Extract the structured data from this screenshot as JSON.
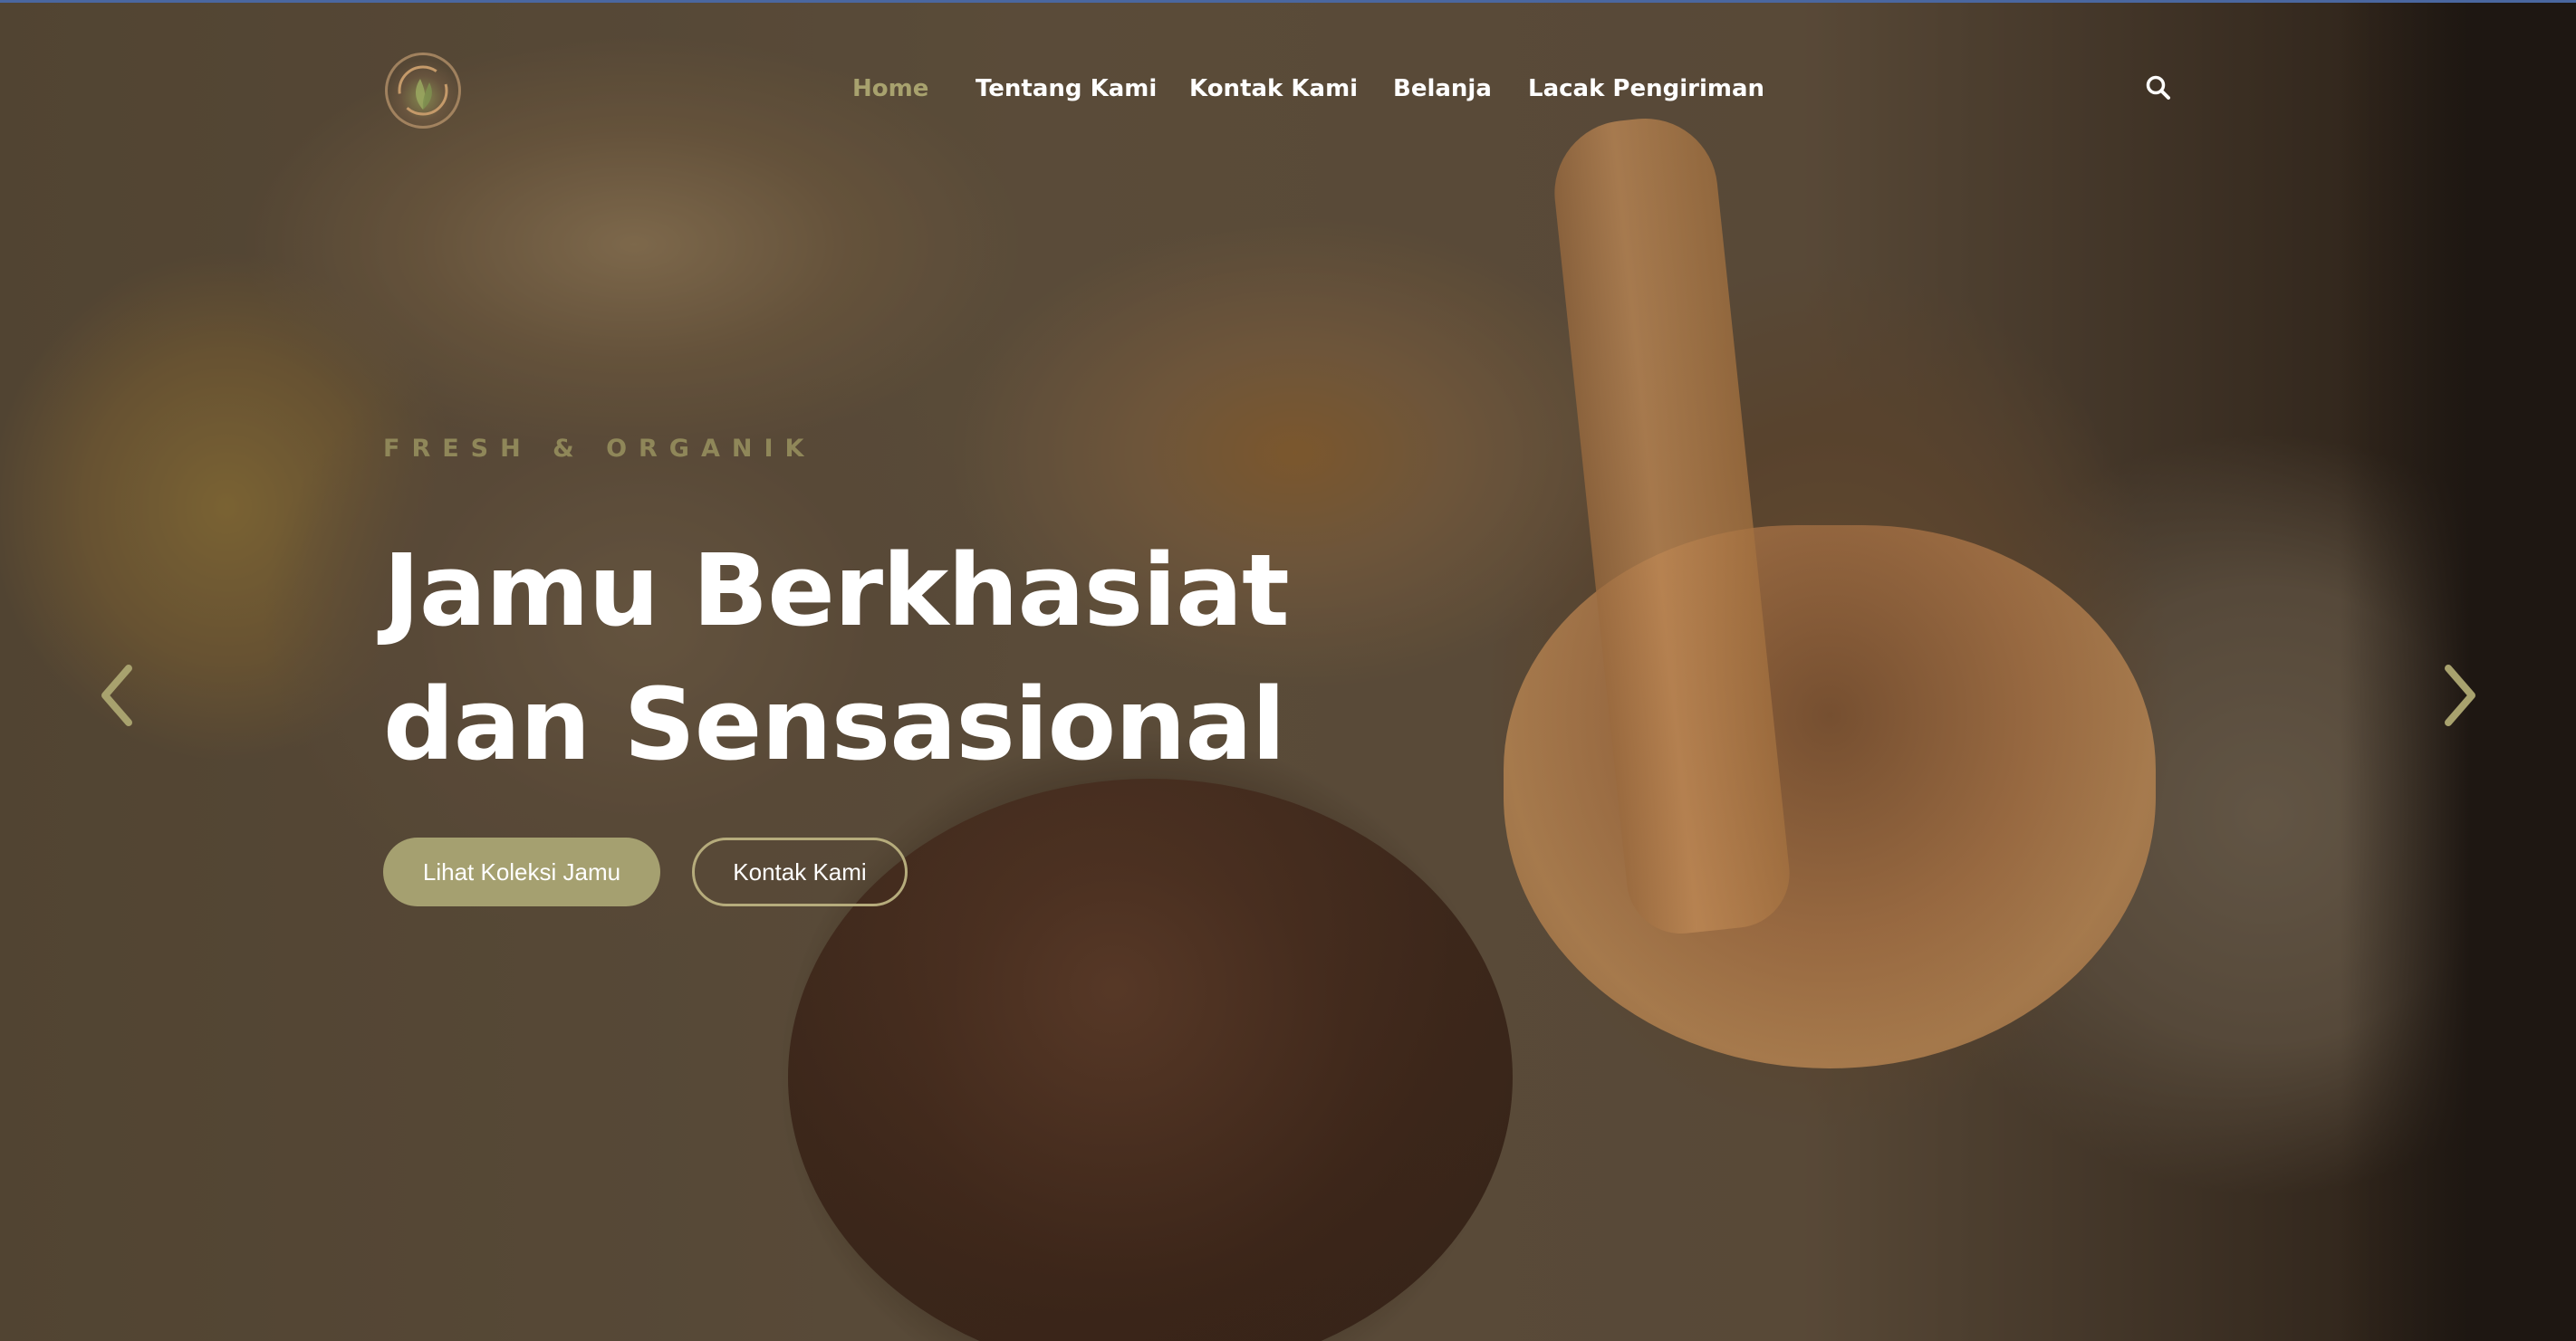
{
  "nav": {
    "logo_icon": "herbal-leaf-logo",
    "items": [
      {
        "label": "Home",
        "active": true
      },
      {
        "label": "Tentang Kami",
        "active": false
      },
      {
        "label": "Kontak Kami",
        "active": false
      },
      {
        "label": "Belanja",
        "active": false
      },
      {
        "label": "Lacak Pengiriman",
        "active": false
      }
    ],
    "search_icon": "search-icon"
  },
  "hero": {
    "eyebrow": "FRESH & ORGANIK",
    "headline_line1": "Jamu Berkhasiat",
    "headline_line2": "dan Sensasional",
    "primary_button": "Lihat Koleksi Jamu",
    "secondary_button": "Kontak Kami",
    "prev_icon": "chevron-left-icon",
    "next_icon": "chevron-right-icon"
  },
  "colors": {
    "accent": "#a5a070",
    "nav_active": "#a8a26e",
    "eyebrow": "#8f8759",
    "text": "#ffffff"
  }
}
